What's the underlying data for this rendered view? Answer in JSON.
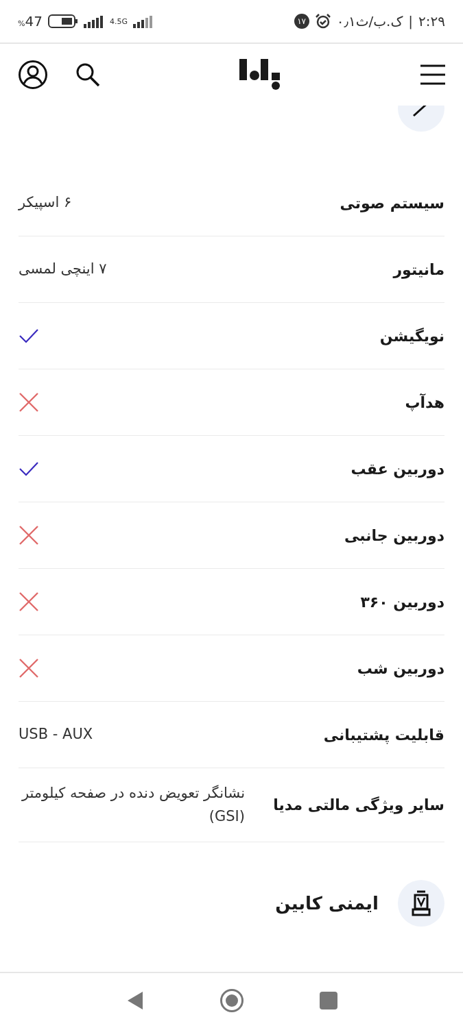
{
  "status_bar": {
    "time": "۲:۲۹",
    "separator": "|",
    "speed": "۰٫۱ک.ب/ث",
    "notification_count": "۱۷",
    "network": "4.5G",
    "battery": "47",
    "battery_unit": "%"
  },
  "rows": [
    {
      "label": "سیستم صوتی",
      "kind": "text",
      "value": "۶ اسپیکر"
    },
    {
      "label": "مانیتور",
      "kind": "text",
      "value": "۷ اینچی لمسی"
    },
    {
      "label": "نویگیشن",
      "kind": "flag",
      "available": true
    },
    {
      "label": "هدآپ",
      "kind": "flag",
      "available": false
    },
    {
      "label": "دوربین عقب",
      "kind": "flag",
      "available": true
    },
    {
      "label": "دوربین جانبی",
      "kind": "flag",
      "available": false
    },
    {
      "label": "دوربین ۳۶۰",
      "kind": "flag",
      "available": false
    },
    {
      "label": "دوربین شب",
      "kind": "flag",
      "available": false
    },
    {
      "label": "قابلیت پشتیبانی",
      "kind": "text",
      "value": "USB - AUX"
    },
    {
      "label": "سایر ویژگی مالتی مدیا",
      "kind": "text",
      "value": "نشانگر تعویض دنده در صفحه کیلومتر (GSI)"
    }
  ],
  "next_section": {
    "title": "ایمنی کابین"
  }
}
